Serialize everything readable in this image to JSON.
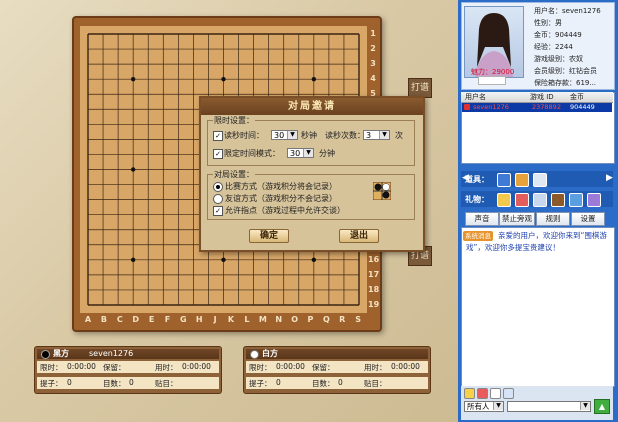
{
  "board": {
    "col_labels": [
      "A",
      "B",
      "C",
      "D",
      "E",
      "F",
      "G",
      "H",
      "J",
      "K",
      "L",
      "M",
      "N",
      "O",
      "P",
      "Q",
      "R",
      "S"
    ],
    "row_labels_top": [
      "1",
      "2",
      "3",
      "4",
      "5"
    ],
    "row_labels_bottom": [
      "16",
      "17",
      "18",
      "19"
    ],
    "side_tab_top": "打谱",
    "side_tab_bottom": "打谱"
  },
  "dialog": {
    "title": "对局邀请",
    "limit_group_title": "限时设置：",
    "read_time_label": "读秒时间：",
    "read_time_value": "30",
    "read_time_unit": "秒钟",
    "read_count_label": "读秒次数：",
    "read_count_value": "3",
    "read_count_unit": "次",
    "limit_mode_label": "限定时间模式：",
    "limit_mode_value": "30",
    "limit_mode_unit": "分钟",
    "match_group_title": "对局设置：",
    "mode_ranked": "比赛方式（游戏积分将会记录）",
    "mode_friendly": "友谊方式（游戏积分不会记录）",
    "allow_hints": "允许指点（游戏过程中允许交谈）",
    "confirm_label": "确定",
    "exit_label": "退出"
  },
  "black_panel": {
    "title": "黑方",
    "player": "seven1276",
    "limit_label": "限时：",
    "limit_value": "0:00:00",
    "keep_label": "保留：",
    "used_label": "用时：",
    "used_value": "0:00:00",
    "captured_label": "提子：",
    "captured_value": "0",
    "moves_label": "目数：",
    "moves_value": "0",
    "komi_label": "贴目："
  },
  "white_panel": {
    "title": "白方",
    "player": "",
    "limit_label": "限时：",
    "limit_value": "0:00:00",
    "keep_label": "保留：",
    "used_label": "用时：",
    "used_value": "0:00:00",
    "captured_label": "提子：",
    "captured_value": "0",
    "moves_label": "目数：",
    "moves_value": "0",
    "komi_label": "贴目："
  },
  "profile": {
    "username_label": "用户名：",
    "username": "seven1276",
    "gender_label": "性别：",
    "gender": "男",
    "gold_label": "金币：",
    "gold": "904449",
    "exp_label": "经验：",
    "exp": "2244",
    "game_level_label": "游戏级别：",
    "game_level": "农奴",
    "member_level_label": "会员级别：",
    "member_level": "红钻会员",
    "insurance_label": "保险箱存款：",
    "insurance": "619...",
    "charm_label": "魅力：",
    "charm": "29000"
  },
  "player_list": {
    "headers": [
      "用户名",
      "游戏 ID",
      "金币"
    ],
    "rows": [
      {
        "name": "seven1276",
        "id": "2378892",
        "gold": "904449"
      }
    ]
  },
  "toolbar": {
    "props_label": "道具：",
    "gifts_label": "礼物："
  },
  "chat_buttons": {
    "sound": "声音",
    "block": "禁止旁观",
    "rules": "规则",
    "settings": "设置"
  },
  "chat": {
    "badge": "系统消息",
    "message": "亲爱的用户，欢迎你来到“围棋游戏”，欢迎你多提宝贵建议！"
  },
  "bottom": {
    "target": "所有人"
  },
  "colors": {
    "board": "#d8a768",
    "frame": "#a0622c",
    "panel_blue": "#2a6cc7"
  }
}
